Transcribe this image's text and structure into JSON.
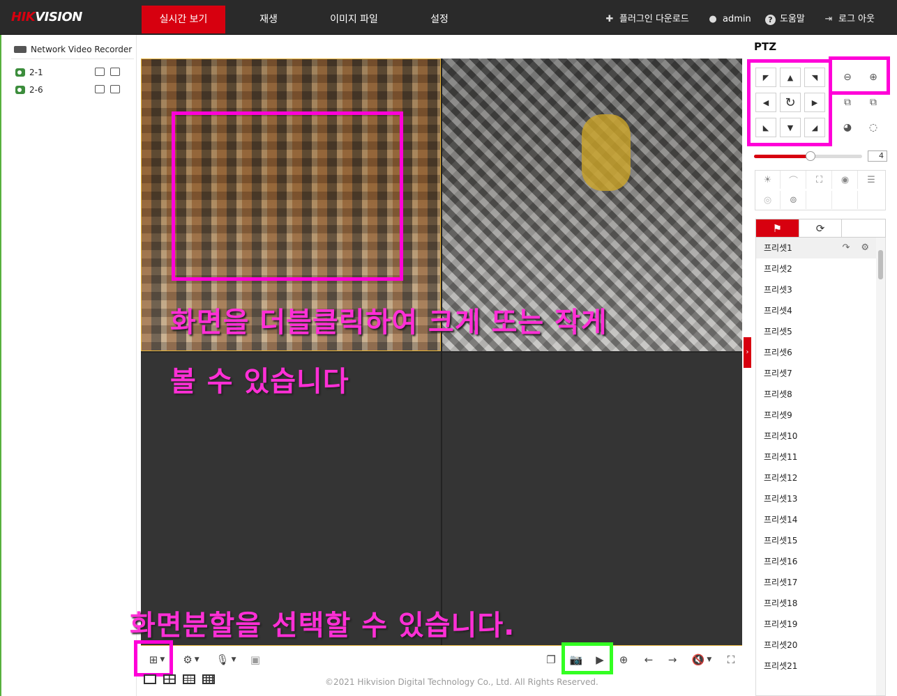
{
  "brand": {
    "logo_red": "HIK",
    "logo_white": "VISION"
  },
  "nav": {
    "tabs": [
      {
        "label": "실시간 보기",
        "active": true
      },
      {
        "label": "재생",
        "active": false
      },
      {
        "label": "이미지 파일",
        "active": false
      },
      {
        "label": "설정",
        "active": false
      }
    ],
    "right": {
      "plugin": "플러그인 다운로드",
      "user": "admin",
      "help": "도움말",
      "logout": "로그 아웃"
    }
  },
  "device_tree": {
    "root": "Network Video Recorder",
    "cameras": [
      {
        "name": "2-1"
      },
      {
        "name": "2-6"
      }
    ]
  },
  "overlays": {
    "double_click_line1": "화면을 더블클릭하여 크게 또는 작게",
    "double_click_line2": "볼 수 있습니다",
    "split_hint": "화면분할을 선택할 수 있습니다."
  },
  "ptz": {
    "title": "PTZ",
    "speed": 4,
    "speed_fraction": 0.52,
    "tabs": [
      "preset-icon",
      "patrol-icon",
      ""
    ],
    "presets": [
      "프리셋1",
      "프리셋2",
      "프리셋3",
      "프리셋4",
      "프리셋5",
      "프리셋6",
      "프리셋7",
      "프리셋8",
      "프리셋9",
      "프리셋10",
      "프리셋11",
      "프리셋12",
      "프리셋13",
      "프리셋14",
      "프리셋15",
      "프리셋16",
      "프리셋17",
      "프리셋18",
      "프리셋19",
      "프리셋20",
      "프리셋21"
    ]
  },
  "footer": {
    "copyright": "©2021 Hikvision Digital Technology Co., Ltd. All Rights Reserved."
  },
  "colors": {
    "brand_red": "#d7000f",
    "highlight_magenta": "#ff00d8",
    "highlight_green": "#33ff22",
    "topbar": "#2a2a2a"
  }
}
